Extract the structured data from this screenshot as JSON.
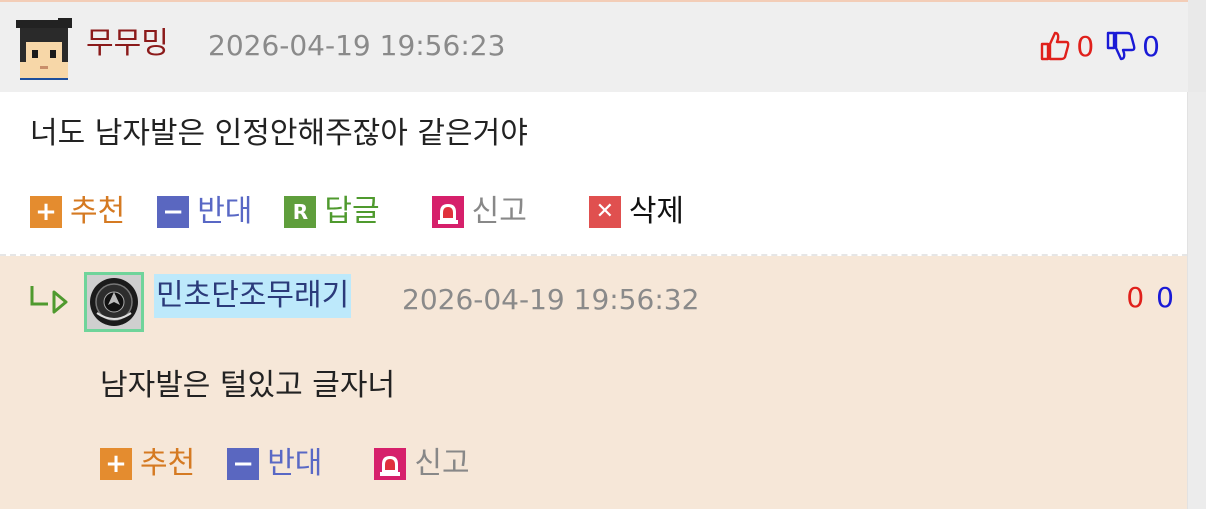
{
  "comment": {
    "nickname": "무무밍",
    "timestamp": "2026-04-19 19:56:23",
    "upvotes": "0",
    "downvotes": "0",
    "text": "너도 남자발은 인정안해주잖아 같은거야",
    "actions": {
      "recommend": "추천",
      "oppose": "반대",
      "reply": "답글",
      "report": "신고",
      "delete": "삭제"
    }
  },
  "reply": {
    "nickname": "민초단조무래기",
    "timestamp": "2026-04-19 19:56:32",
    "upvotes": "0",
    "downvotes": "0",
    "text": "남자발은 털있고 글자너",
    "actions": {
      "recommend": "추천",
      "oppose": "반대",
      "report": "신고"
    }
  },
  "icons": {
    "thumb_up": "thumbs-up-icon",
    "thumb_down": "thumbs-down-icon",
    "plus": "plus-icon",
    "minus": "minus-icon",
    "reply": "reply-r-icon",
    "report": "siren-icon",
    "delete": "close-x-icon",
    "reply_arrow": "reply-arrow-icon"
  },
  "colors": {
    "header_bg": "#efefef",
    "reply_bg": "#f6e7d8",
    "nickname": "#8b1a1a",
    "upvote": "#e0201b",
    "downvote": "#1a1ad6",
    "recommend": "#e48c2f",
    "oppose": "#5a67c0",
    "reply_green": "#5f9e3c",
    "report_pink": "#d6206b",
    "delete_red": "#e0504f",
    "highlight": "#bde9fb"
  }
}
